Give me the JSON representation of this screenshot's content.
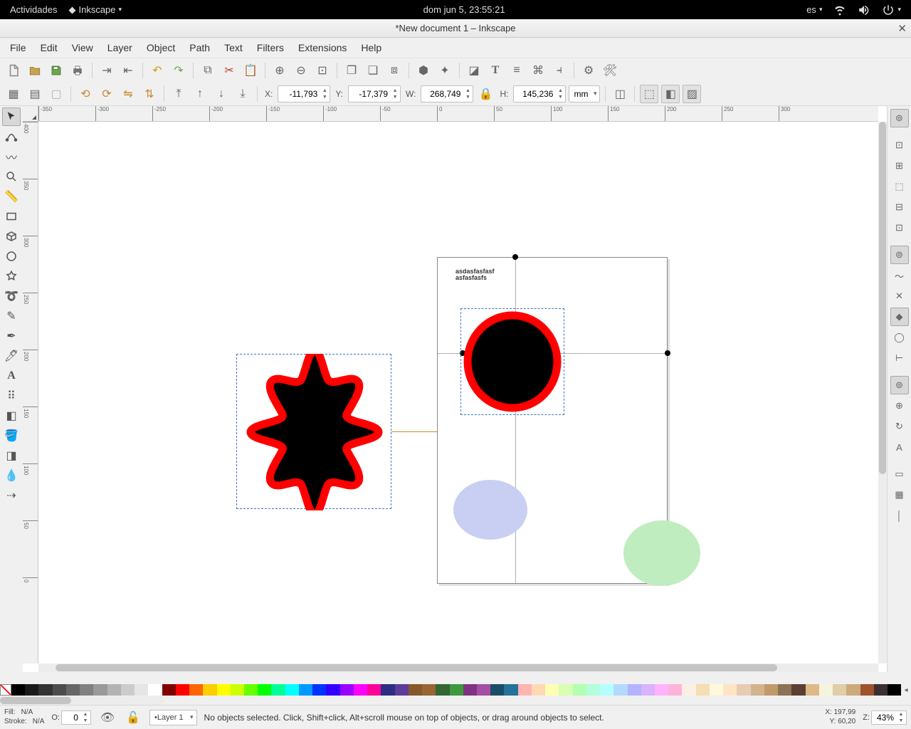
{
  "gnome": {
    "activities": "Actividades",
    "app": "Inkscape",
    "clock": "dom jun  5, 23:55:21",
    "lang": "es"
  },
  "window": {
    "title": "*New document 1 – Inkscape"
  },
  "menus": [
    "File",
    "Edit",
    "View",
    "Layer",
    "Object",
    "Path",
    "Text",
    "Filters",
    "Extensions",
    "Help"
  ],
  "coords": {
    "x_label": "X:",
    "x": "-11,793",
    "y_label": "Y:",
    "y": "-17,379",
    "w_label": "W:",
    "w": "268,749",
    "h_label": "H:",
    "h": "145,236",
    "unit": "mm"
  },
  "ruler_h": [
    "-350",
    "-300",
    "-250",
    "-200",
    "-150",
    "-100",
    "-50",
    "0",
    "50",
    "100",
    "150",
    "200",
    "250",
    "300"
  ],
  "ruler_v": [
    "400",
    "350",
    "300",
    "250",
    "200",
    "150",
    "100",
    "50",
    "0"
  ],
  "canvas_text": {
    "line1": "asdasfasfasf",
    "line2": "asfasfasfs"
  },
  "status": {
    "fill_label": "Fill:",
    "fill_value": "N/A",
    "stroke_label": "Stroke:",
    "stroke_value": "N/A",
    "opacity_label": "O:",
    "opacity_value": "0",
    "layer": "•Layer 1",
    "message": "No objects selected. Click, Shift+click, Alt+scroll mouse on top of objects, or drag around objects to select.",
    "cursor_x_label": "X:",
    "cursor_x": "197,99",
    "cursor_y_label": "Y:",
    "cursor_y": "60,20",
    "zoom_label": "Z:",
    "zoom": "43%"
  },
  "palette_colors": [
    "#000000",
    "#1a1a1a",
    "#333333",
    "#4d4d4d",
    "#666666",
    "#808080",
    "#999999",
    "#b3b3b3",
    "#cccccc",
    "#e6e6e6",
    "#ffffff",
    "#800000",
    "#ff0000",
    "#ff6600",
    "#ffcc00",
    "#ffff00",
    "#ccff00",
    "#66ff00",
    "#00ff00",
    "#00ff99",
    "#00ffff",
    "#0099ff",
    "#0033ff",
    "#3300ff",
    "#9900ff",
    "#ff00ff",
    "#ff0099",
    "#2d2d86",
    "#5c3d99",
    "#86592d",
    "#996633",
    "#336633",
    "#3d993d",
    "#803380",
    "#a64da6",
    "#1a4d66",
    "#267399",
    "#ffb3b3",
    "#ffd9b3",
    "#ffffb3",
    "#d9ffb3",
    "#b3ffb3",
    "#b3ffd9",
    "#b3ffff",
    "#b3d9ff",
    "#b3b3ff",
    "#d9b3ff",
    "#ffb3ff",
    "#ffb3d9",
    "#faf0e6",
    "#f5deb3",
    "#fff8dc",
    "#ffe4c4",
    "#e6ccb3",
    "#d2b48c",
    "#c19a6b",
    "#8b7355",
    "#5c4033",
    "#deb887",
    "#f5f5dc",
    "#e0cda9",
    "#cdaa7d",
    "#a0522d",
    "#3b2f2f",
    "#000000"
  ]
}
